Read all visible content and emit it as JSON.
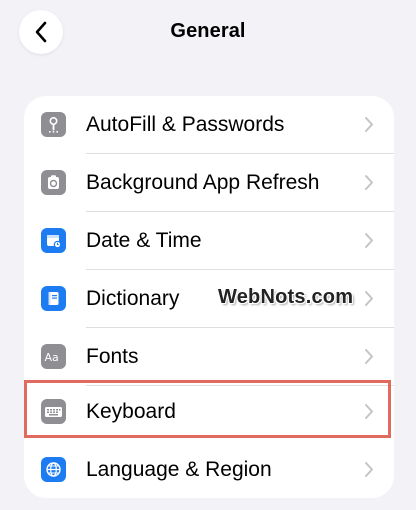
{
  "nav": {
    "title": "General",
    "back_icon": "chevron-left-icon"
  },
  "settings": {
    "items": [
      {
        "label": "AutoFill & Passwords",
        "icon": "key-icon",
        "icon_color": "#8e8e93"
      },
      {
        "label": "Background App Refresh",
        "icon": "refresh-icon",
        "icon_color": "#8e8e93"
      },
      {
        "label": "Date & Time",
        "icon": "calendar-clock-icon",
        "icon_color": "#1e7cf2"
      },
      {
        "label": "Dictionary",
        "icon": "book-icon",
        "icon_color": "#1e7cf2"
      },
      {
        "label": "Fonts",
        "icon": "fonts-icon",
        "icon_color": "#8e8e93"
      },
      {
        "label": "Keyboard",
        "icon": "keyboard-icon",
        "icon_color": "#8e8e93",
        "highlighted": true
      },
      {
        "label": "Language & Region",
        "icon": "globe-icon",
        "icon_color": "#1e7cf2"
      }
    ]
  },
  "watermark": {
    "text": "WebNots.com"
  },
  "colors": {
    "background": "#f2f2f7",
    "card": "#ffffff",
    "highlight": "#e06a5e",
    "chevron": "#c4c4c7"
  }
}
